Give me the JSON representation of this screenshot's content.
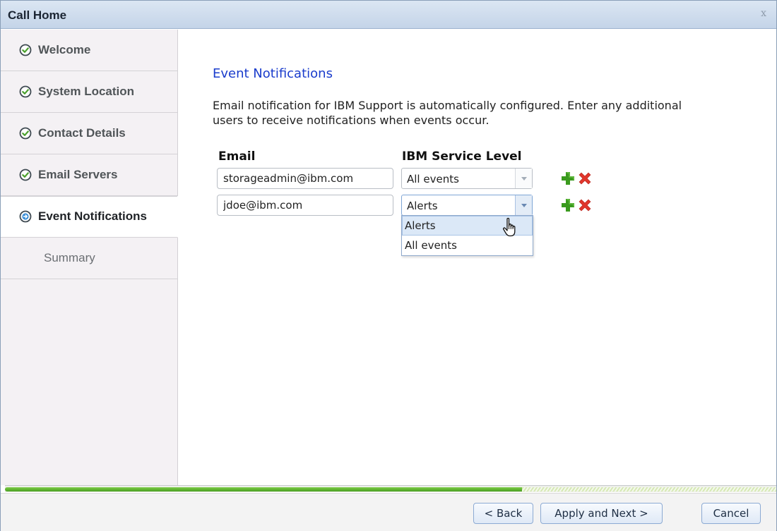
{
  "window": {
    "title": "Call Home",
    "close_label": "x"
  },
  "sidebar": {
    "steps": [
      {
        "label": "Welcome",
        "state": "done"
      },
      {
        "label": "System Location",
        "state": "done"
      },
      {
        "label": "Contact Details",
        "state": "done"
      },
      {
        "label": "Email Servers",
        "state": "done"
      },
      {
        "label": "Event Notifications",
        "state": "current"
      },
      {
        "label": "Summary",
        "state": "pending"
      }
    ]
  },
  "main": {
    "heading": "Event Notifications",
    "description": "Email notification for IBM Support is automatically configured. Enter any additional users to receive notifications when events occur.",
    "columns": {
      "email": "Email",
      "service_level": "IBM Service Level"
    },
    "rows": [
      {
        "email": "storageadmin@ibm.com",
        "level": "All events"
      },
      {
        "email": "jdoe@ibm.com",
        "level": "Alerts"
      }
    ],
    "dropdown_options": [
      "Alerts",
      "All events"
    ],
    "dropdown_hovered": "Alerts"
  },
  "progress": {
    "fraction": 0.67
  },
  "footer": {
    "back": "< Back",
    "apply_next": "Apply and Next >",
    "cancel": "Cancel"
  },
  "colors": {
    "heading": "#1a3ccc",
    "progress_green": "#5cb030",
    "add_icon": "#3a9a1e",
    "delete_icon": "#e0362c"
  },
  "icons": {
    "done": "check-circle-icon",
    "current": "arrow-circle-icon",
    "add": "plus-icon",
    "delete": "x-icon",
    "cursor": "hand-pointer-icon"
  }
}
